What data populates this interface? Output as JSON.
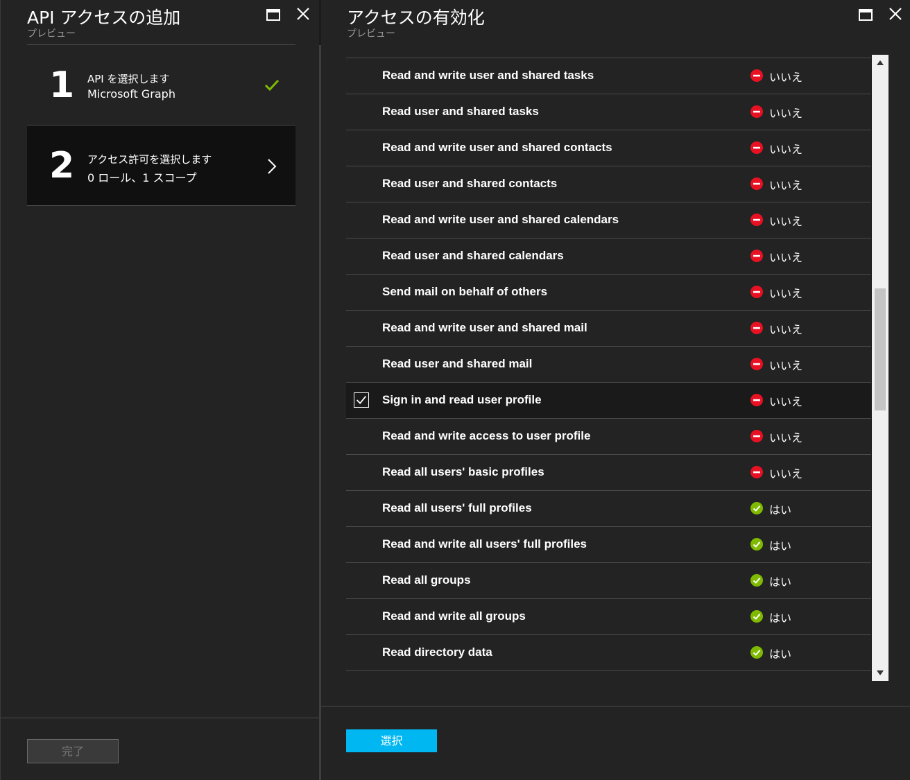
{
  "left_blade": {
    "title": "API アクセスの追加",
    "subtitle": "プレビュー",
    "steps": [
      {
        "number": "1",
        "line1": "API を選択します",
        "line2": "Microsoft Graph",
        "state_icon": "checkmark-icon"
      },
      {
        "number": "2",
        "line1": "アクセス許可を選択します",
        "line2": "0 ロール、1 スコープ",
        "state_icon": "chevron-right-icon"
      }
    ],
    "done_label": "完了"
  },
  "right_blade": {
    "title": "アクセスの有効化",
    "subtitle": "プレビュー",
    "select_label": "選択",
    "permissions": [
      {
        "name": "Read and write user and shared tasks",
        "admin": "いいえ",
        "status": "no",
        "selected": false
      },
      {
        "name": "Read user and shared tasks",
        "admin": "いいえ",
        "status": "no",
        "selected": false
      },
      {
        "name": "Read and write user and shared contacts",
        "admin": "いいえ",
        "status": "no",
        "selected": false
      },
      {
        "name": "Read user and shared contacts",
        "admin": "いいえ",
        "status": "no",
        "selected": false
      },
      {
        "name": "Read and write user and shared calendars",
        "admin": "いいえ",
        "status": "no",
        "selected": false
      },
      {
        "name": "Read user and shared calendars",
        "admin": "いいえ",
        "status": "no",
        "selected": false
      },
      {
        "name": "Send mail on behalf of others",
        "admin": "いいえ",
        "status": "no",
        "selected": false
      },
      {
        "name": "Read and write user and shared mail",
        "admin": "いいえ",
        "status": "no",
        "selected": false
      },
      {
        "name": "Read user and shared mail",
        "admin": "いいえ",
        "status": "no",
        "selected": false
      },
      {
        "name": "Sign in and read user profile",
        "admin": "いいえ",
        "status": "no",
        "selected": true
      },
      {
        "name": "Read and write access to user profile",
        "admin": "いいえ",
        "status": "no",
        "selected": false
      },
      {
        "name": "Read all users' basic profiles",
        "admin": "いいえ",
        "status": "no",
        "selected": false
      },
      {
        "name": "Read all users' full profiles",
        "admin": "はい",
        "status": "yes",
        "selected": false
      },
      {
        "name": "Read and write all users' full profiles",
        "admin": "はい",
        "status": "yes",
        "selected": false
      },
      {
        "name": "Read all groups",
        "admin": "はい",
        "status": "yes",
        "selected": false
      },
      {
        "name": "Read and write all groups",
        "admin": "はい",
        "status": "yes",
        "selected": false
      },
      {
        "name": "Read directory data",
        "admin": "はい",
        "status": "yes",
        "selected": false
      }
    ],
    "scroll_position": 0.46
  },
  "colors": {
    "accent": "#00b7f1",
    "yes": "#7fba00",
    "no": "#e81123",
    "check": "#7fba00"
  }
}
